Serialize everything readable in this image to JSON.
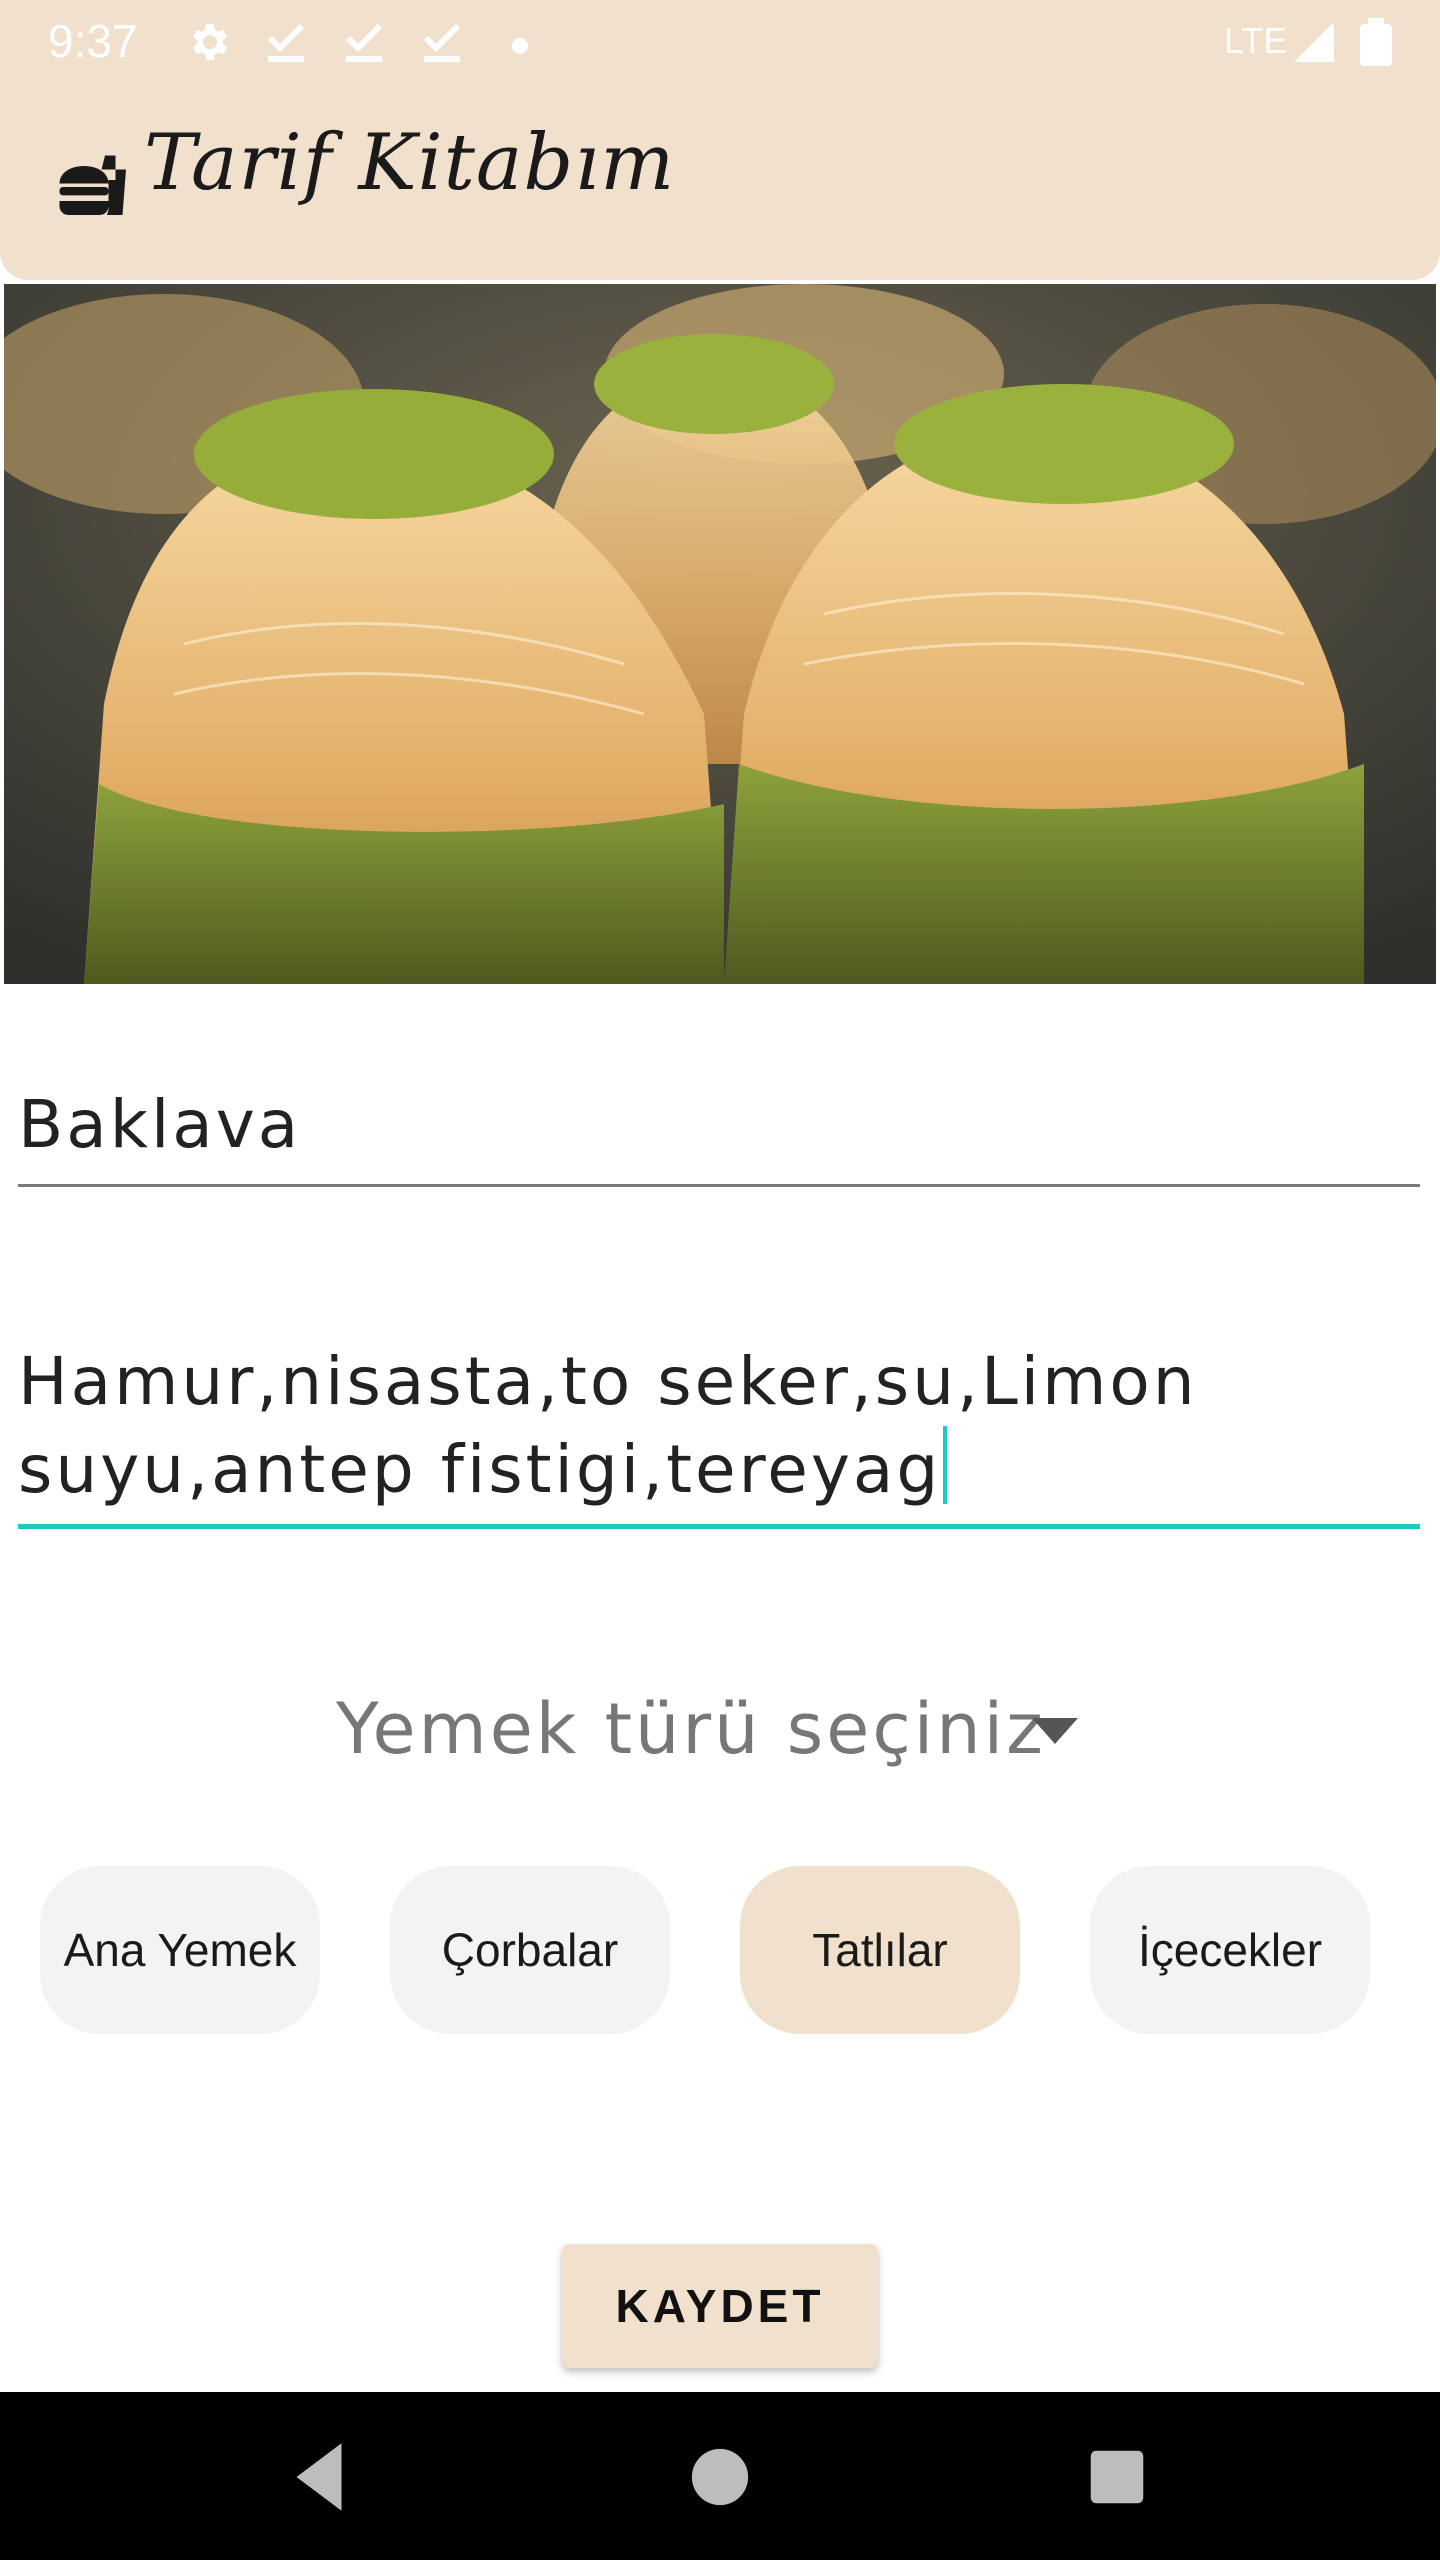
{
  "status_bar": {
    "time": "9:37",
    "network": "LTE",
    "icons": [
      "settings-gear-icon",
      "check-download-icon",
      "check-download-icon",
      "check-download-icon",
      "dot-icon",
      "signal-icon",
      "battery-icon"
    ]
  },
  "app_bar": {
    "title": "Tarif Kitabım",
    "logo": "fastfood-icon",
    "background": "#F0E0CC"
  },
  "hero_image": {
    "subject": "baklava-photo"
  },
  "form": {
    "recipe_name": "Baklava",
    "ingredients": "Hamur,nisasta,to seker,su,Limon suyu,antep fistigi,tereyag",
    "focus_color": "#1ACCC0"
  },
  "spinner": {
    "label": "Yemek türü seçiniz"
  },
  "categories": [
    {
      "label": "Ana Yemek",
      "selected": false
    },
    {
      "label": "Çorbalar",
      "selected": false
    },
    {
      "label": "Tatlılar",
      "selected": true
    },
    {
      "label": "İçecekler",
      "selected": false
    }
  ],
  "save_button": {
    "label": "KAYDET"
  },
  "nav_bar": {
    "icons": [
      "back-icon",
      "home-icon",
      "recents-icon"
    ]
  }
}
